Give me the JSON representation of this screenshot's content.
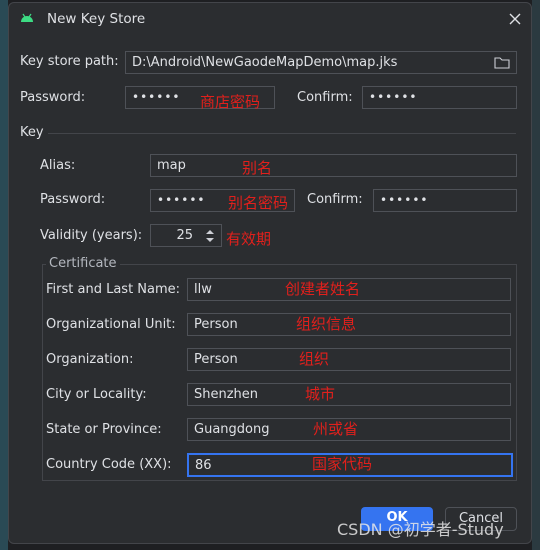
{
  "dialog": {
    "title": "New Key Store",
    "close_icon": "close-icon",
    "app_icon": "android-icon"
  },
  "keystore": {
    "path_label": "Key store path:",
    "path_value": "D:\\Android\\NewGaodeMapDemo\\map.jks",
    "folder_icon": "folder-icon",
    "password_label": "Password:",
    "password_value": "••••••",
    "confirm_label": "Confirm:",
    "confirm_value": "••••••"
  },
  "key": {
    "section_label": "Key",
    "alias_label": "Alias:",
    "alias_value": "map",
    "password_label": "Password:",
    "password_value": "••••••",
    "confirm_label": "Confirm:",
    "confirm_value": "••••••",
    "validity_label": "Validity (years):",
    "validity_value": "25"
  },
  "certificate": {
    "group_label": "Certificate",
    "fields": [
      {
        "label": "First and Last Name:",
        "value": "llw",
        "note": "创建者姓名"
      },
      {
        "label": "Organizational Unit:",
        "value": "Person",
        "note": "组织信息"
      },
      {
        "label": "Organization:",
        "value": "Person",
        "note": "组织"
      },
      {
        "label": "City or Locality:",
        "value": "Shenzhen",
        "note": "城市"
      },
      {
        "label": "State or Province:",
        "value": "Guangdong",
        "note": "州或省"
      },
      {
        "label": "Country Code (XX):",
        "value": "86",
        "note": "国家代码"
      }
    ]
  },
  "notes": {
    "store_password": "商店密码",
    "alias": "别名",
    "key_password": "别名密码",
    "validity": "有效期"
  },
  "buttons": {
    "ok": "OK",
    "cancel": "Cancel"
  },
  "watermark": "CSDN @初学者-Study",
  "colors": {
    "accent": "#3574f0",
    "annotation": "#e0201c",
    "background": "#2b2d30"
  }
}
